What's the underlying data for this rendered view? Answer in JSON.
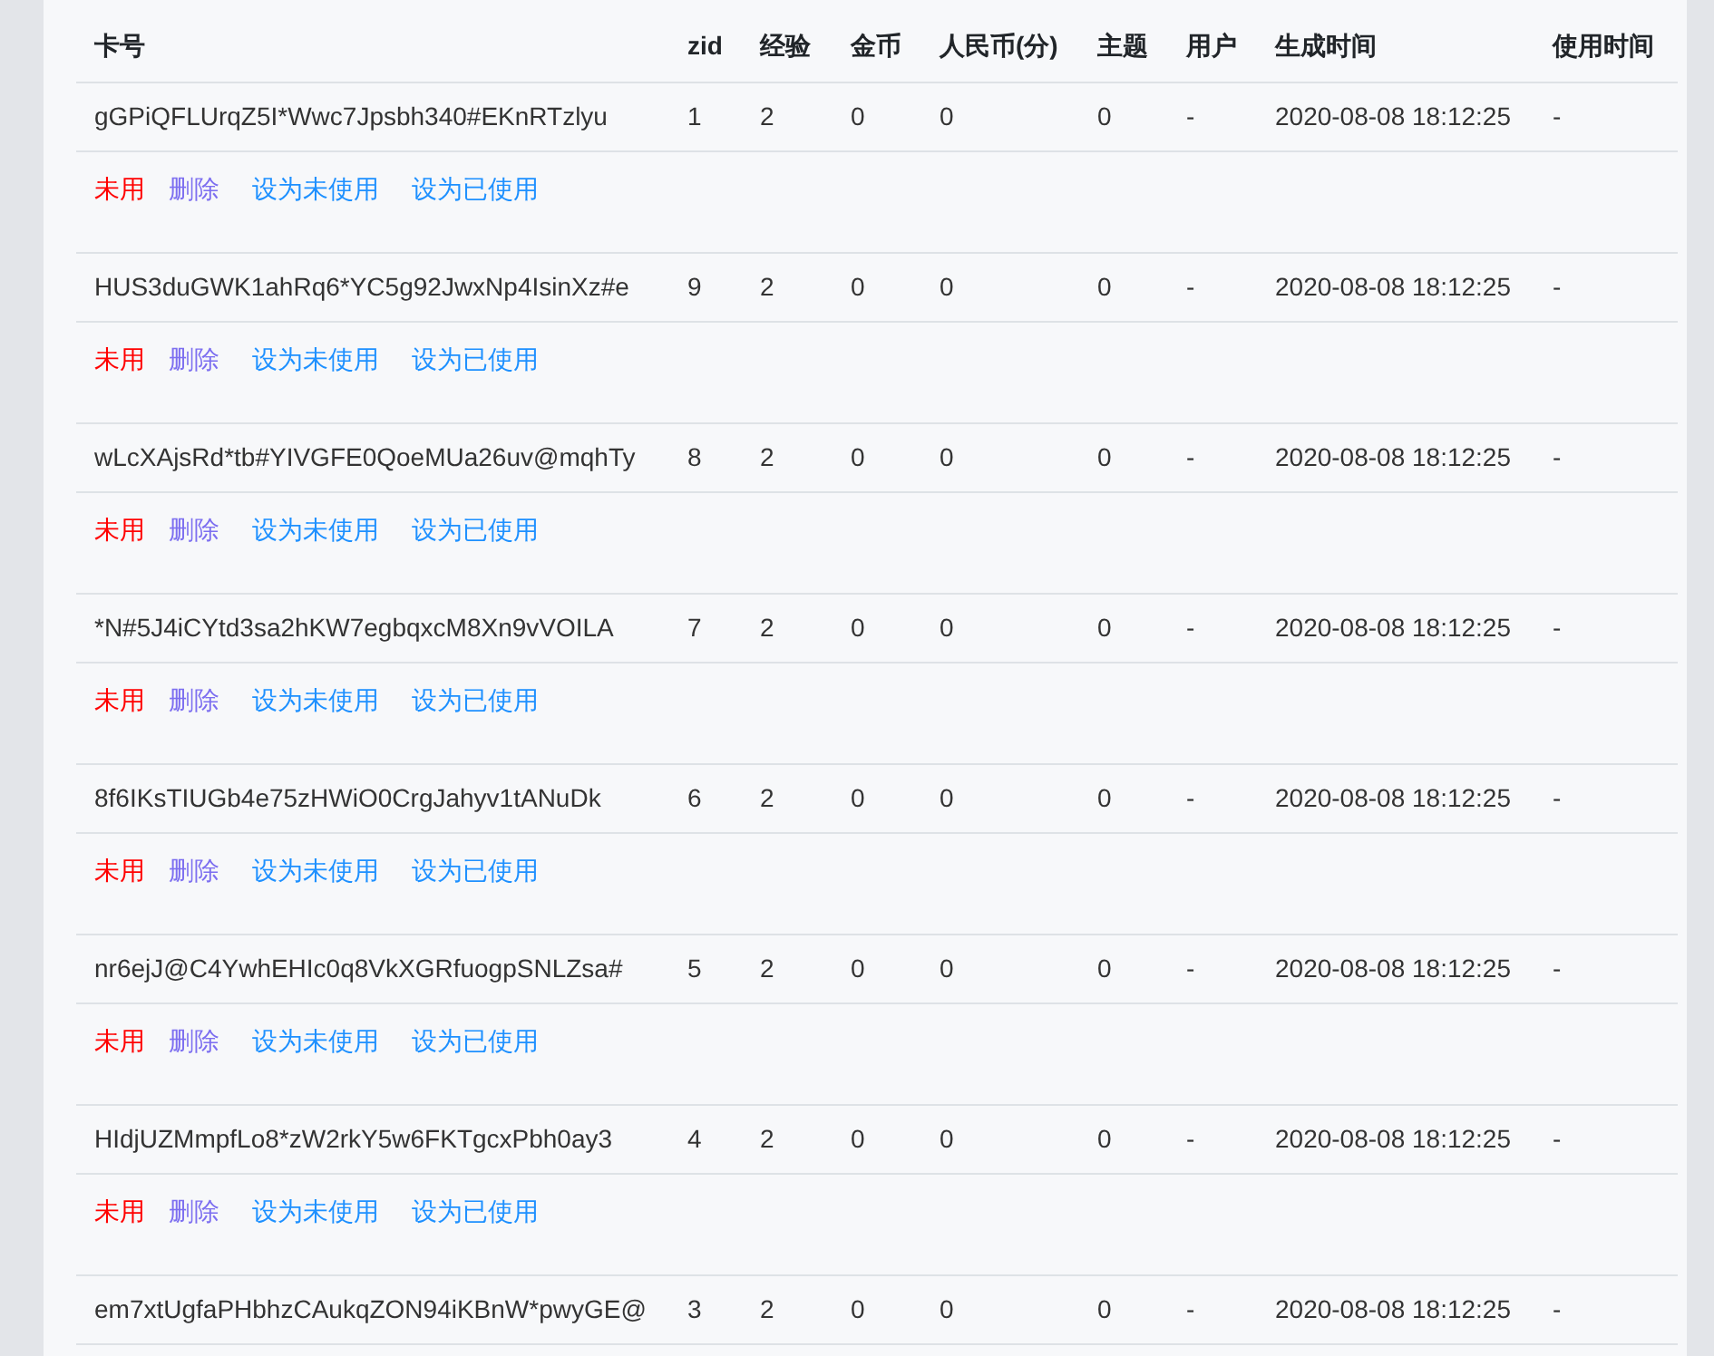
{
  "table": {
    "columns": [
      "卡号",
      "zid",
      "经验",
      "金币",
      "人民币(分)",
      "主题",
      "用户",
      "生成时间",
      "使用时间"
    ],
    "rows": [
      {
        "cells": [
          "gGPiQFLUrqZ5I*Wwc7Jpsbh340#EKnRTzlyu",
          "1",
          "2",
          "0",
          "0",
          "0",
          "-",
          "2020-08-08 18:12:25",
          "-"
        ],
        "status": {
          "label": "未用",
          "kind": "unused"
        },
        "actions": [
          "删除",
          "设为未使用",
          "设为已使用"
        ]
      },
      {
        "cells": [
          "HUS3duGWK1ahRq6*YC5g92JwxNp4IsinXz#e",
          "9",
          "2",
          "0",
          "0",
          "0",
          "-",
          "2020-08-08 18:12:25",
          "-"
        ],
        "status": {
          "label": "未用",
          "kind": "unused"
        },
        "actions": [
          "删除",
          "设为未使用",
          "设为已使用"
        ]
      },
      {
        "cells": [
          "wLcXAjsRd*tb#YIVGFE0QoeMUa26uv@mqhTy",
          "8",
          "2",
          "0",
          "0",
          "0",
          "-",
          "2020-08-08 18:12:25",
          "-"
        ],
        "status": {
          "label": "未用",
          "kind": "unused"
        },
        "actions": [
          "删除",
          "设为未使用",
          "设为已使用"
        ]
      },
      {
        "cells": [
          "*N#5J4iCYtd3sa2hKW7egbqxcM8Xn9vVOILA",
          "7",
          "2",
          "0",
          "0",
          "0",
          "-",
          "2020-08-08 18:12:25",
          "-"
        ],
        "status": {
          "label": "未用",
          "kind": "unused"
        },
        "actions": [
          "删除",
          "设为未使用",
          "设为已使用"
        ]
      },
      {
        "cells": [
          "8f6IKsTIUGb4e75zHWiO0CrgJahyv1tANuDk",
          "6",
          "2",
          "0",
          "0",
          "0",
          "-",
          "2020-08-08 18:12:25",
          "-"
        ],
        "status": {
          "label": "未用",
          "kind": "unused"
        },
        "actions": [
          "删除",
          "设为未使用",
          "设为已使用"
        ]
      },
      {
        "cells": [
          "nr6ejJ@C4YwhEHIc0q8VkXGRfuogpSNLZsa#",
          "5",
          "2",
          "0",
          "0",
          "0",
          "-",
          "2020-08-08 18:12:25",
          "-"
        ],
        "status": {
          "label": "未用",
          "kind": "unused"
        },
        "actions": [
          "删除",
          "设为未使用",
          "设为已使用"
        ]
      },
      {
        "cells": [
          "HIdjUZMmpfLo8*zW2rkY5w6FKTgcxPbh0ay3",
          "4",
          "2",
          "0",
          "0",
          "0",
          "-",
          "2020-08-08 18:12:25",
          "-"
        ],
        "status": {
          "label": "未用",
          "kind": "unused"
        },
        "actions": [
          "删除",
          "设为未使用",
          "设为已使用"
        ]
      },
      {
        "cells": [
          "em7xtUgfaPHbhzCAukqZON94iKBnW*pwyGE@",
          "3",
          "2",
          "0",
          "0",
          "0",
          "-",
          "2020-08-08 18:12:25",
          "-"
        ]
      }
    ]
  }
}
